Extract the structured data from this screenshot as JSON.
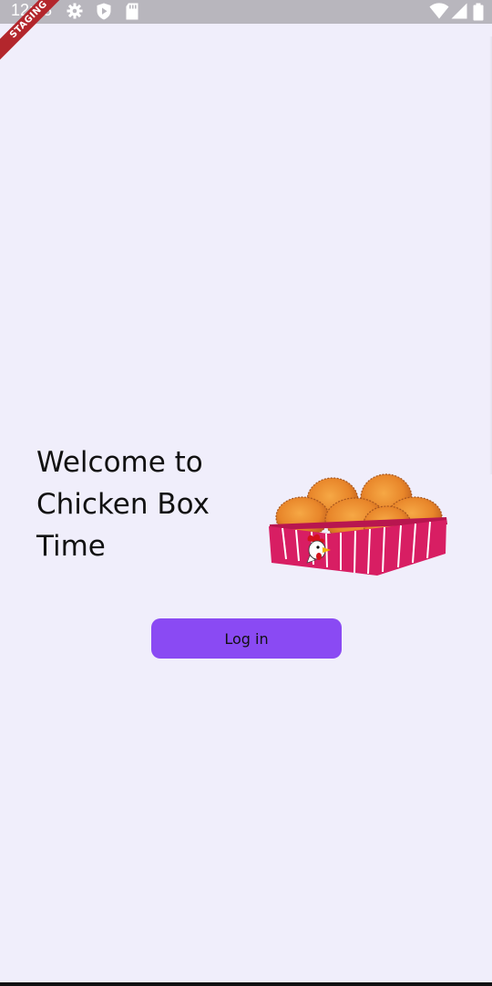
{
  "status_bar": {
    "time": "12:38",
    "icons": [
      "gear-icon",
      "shield-play-icon",
      "sd-card-icon",
      "wifi-icon",
      "signal-icon",
      "battery-icon"
    ]
  },
  "ribbon": {
    "label": "STAGING"
  },
  "welcome": {
    "title": "Welcome to Chicken Box Time"
  },
  "illustration": {
    "name": "chicken-box-illustration"
  },
  "login": {
    "label": "Log in"
  },
  "colors": {
    "background": "#f0eefb",
    "accent": "#8a4af3",
    "box": "#d81e63",
    "ribbon": "#b3262c"
  }
}
